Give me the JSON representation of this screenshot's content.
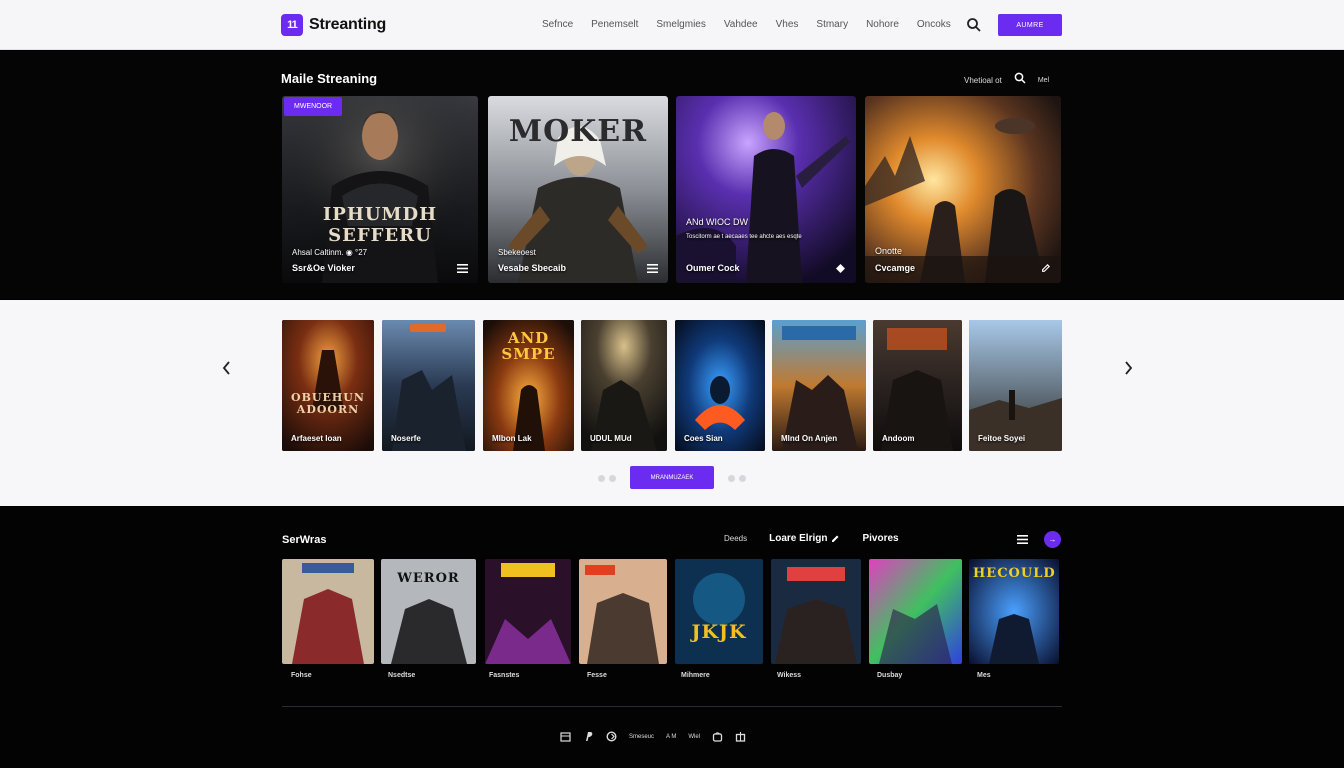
{
  "header": {
    "logo_mark": "11",
    "logo_text": "Streanting",
    "nav": [
      "Sefnce",
      "Penemselt",
      "Smelgmies",
      "Vahdee",
      "Vhes",
      "Stmary",
      "Nohore",
      "Oncoks"
    ],
    "cta_label": "Aumre"
  },
  "hero": {
    "title": "Maile Streaning",
    "tools_label": "Vhetioal ot",
    "tools_small": "Mel",
    "badge": "Mwenoor",
    "cards": [
      {
        "poster": "IPHUMDH SEFFERU",
        "line1": "Ahsal Caltinm. ◉ °27",
        "line2": "Ssr&Oe Vioker"
      },
      {
        "poster": "MOKER",
        "line1": "Sbekeoest",
        "line2": "Vesabe Sbecaib"
      },
      {
        "poster": "",
        "line1": "ANd WIOC DW",
        "line2": "Oumer Cock",
        "sub": "Toscitorm ae t aecaaes tee ahcte aes esqte"
      },
      {
        "poster": "",
        "line1": "Onotte",
        "line2": "Cvcamge"
      }
    ]
  },
  "carousel": {
    "cards": [
      {
        "title": "OBUEHUN ADOORN",
        "label": "Arfaeset Ioan"
      },
      {
        "title": "",
        "label": "Noserfe"
      },
      {
        "title": "AND SMPE",
        "label": "Mlbon Lak"
      },
      {
        "title": "",
        "label": "UDUL MUd"
      },
      {
        "title": "",
        "label": "Coes Sian"
      },
      {
        "title": "",
        "label": "Mlnd On Anjen"
      },
      {
        "title": "",
        "label": "Andoom"
      },
      {
        "title": "",
        "label": "Feitoe Soyei"
      }
    ],
    "button_label": "Mranmuzaek"
  },
  "lower": {
    "title": "SerWras",
    "tab1": "Deeds",
    "tab2": "Loare Elrign",
    "tab3": "Pivores",
    "next_label": "→",
    "cards": [
      {
        "label": "Fohse"
      },
      {
        "label": "Nsedtse"
      },
      {
        "label": "Fasnstes"
      },
      {
        "label": "Fesse"
      },
      {
        "label": "Mihmere"
      },
      {
        "label": "Wikess"
      },
      {
        "label": "Dusbay"
      },
      {
        "label": "Mes"
      }
    ],
    "posters": [
      "",
      "WEROR",
      "",
      "",
      "JKJK",
      "",
      "",
      "HECOULD"
    ],
    "footer": [
      "Smeseuc",
      "A M",
      "Wlel"
    ]
  },
  "colors": {
    "accent": "#6b2bf0",
    "header_bg": "#f6f6f8",
    "dark_bg": "#050506",
    "light_bg": "#f7f7fa"
  }
}
